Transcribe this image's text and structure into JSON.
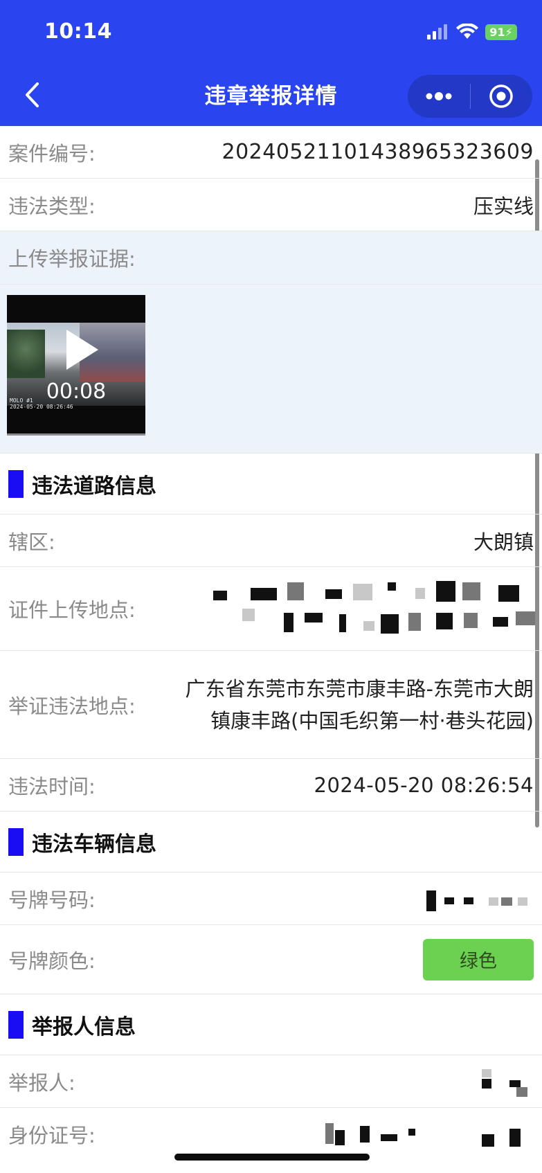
{
  "status_bar": {
    "time": "10:14",
    "battery": "91",
    "icons": [
      "cellular-signal-icon",
      "wifi-icon",
      "battery-charging-icon"
    ]
  },
  "nav": {
    "title": "违章举报详情",
    "back_icon": "chevron-left-icon",
    "more_icon": "more-dots-icon",
    "close_icon": "target-circle-icon"
  },
  "case": {
    "case_no_label": "案件编号:",
    "case_no": "20240521101438965323609",
    "type_label": "违法类型:",
    "type": "压实线",
    "evidence_label": "上传举报证据:",
    "video_duration": "00:08",
    "video_watermark_line1": "MOLO #1",
    "video_watermark_line2": "2024-05-20 08:26:46"
  },
  "road_section": {
    "title": "违法道路信息",
    "district_label": "辖区:",
    "district": "大朗镇",
    "upload_location_label": "证件上传地点:",
    "report_location_label": "举证违法地点:",
    "report_location": "广东省东莞市东莞市康丰路-东莞市大朗镇康丰路(中国毛织第一村·巷头花园)",
    "time_label": "违法时间:",
    "time": "2024-05-20 08:26:54"
  },
  "vehicle_section": {
    "title": "违法车辆信息",
    "plate_label": "号牌号码:",
    "plate_color_label": "号牌颜色:",
    "plate_color": "绿色"
  },
  "reporter_section": {
    "title": "举报人信息",
    "reporter_label": "举报人:",
    "id_label": "身份证号:"
  },
  "colors": {
    "header": "#2a44f0",
    "section_bar": "#1a0df2",
    "plate_green": "#6bd150",
    "evidence_bg": "#edf3fb"
  }
}
